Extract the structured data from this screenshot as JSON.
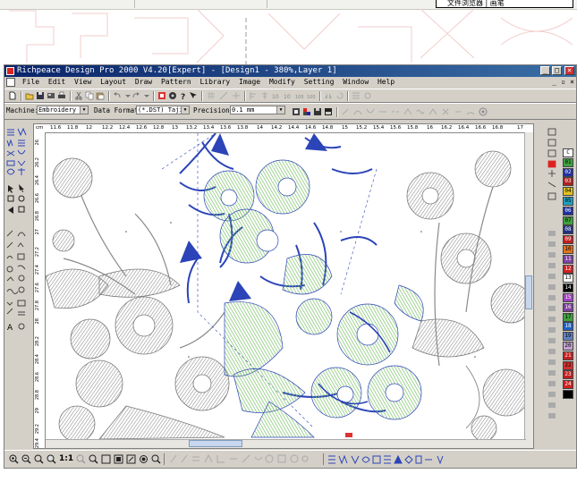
{
  "window": {
    "title": "Richpeace Design Pro 2000 V4.20[Expert] - [Design1 - 380%,Layer 1]",
    "controls": {
      "minimize": "_",
      "maximize": "□",
      "close": "×"
    },
    "doc_controls": {
      "minimize": "_",
      "restore": "▫",
      "close": "×"
    }
  },
  "menu": [
    "File",
    "Edit",
    "View",
    "Layout",
    "Draw",
    "Pattern",
    "Library",
    "Image",
    "Modify",
    "Setting",
    "Window",
    "Help"
  ],
  "property_bar": {
    "machine_label": "Machine:",
    "machine_value": "Embroidery Ma",
    "data_format_label": "Data Format:",
    "data_format_value": "(*.DST) Tajim",
    "precision_label": "Precision:",
    "precision_value": "0.1 mm"
  },
  "ruler": {
    "unit": "cm",
    "x_ticks": [
      "11.6",
      "11.8",
      "12",
      "12.2",
      "12.4",
      "12.6",
      "12.8",
      "13",
      "13.2",
      "13.4",
      "13.6",
      "13.8",
      "14",
      "14.2",
      "14.4",
      "14.6",
      "14.8",
      "15",
      "15.2",
      "15.4",
      "15.6",
      "15.8",
      "16",
      "16.2",
      "16.4",
      "16.6",
      "16.8",
      "17"
    ],
    "y_ticks": [
      "26",
      "26.2",
      "26.4",
      "26.6",
      "26.8",
      "27",
      "27.2",
      "27.4",
      "27.6",
      "27.8",
      "28",
      "28.2",
      "28.4",
      "28.6",
      "28.8",
      "29",
      "29.2",
      "29.4"
    ]
  },
  "color_palette": [
    {
      "num": "C",
      "color": "#ffffff"
    },
    {
      "num": "01",
      "color": "#40a040"
    },
    {
      "num": "02",
      "color": "#2030a0"
    },
    {
      "num": "03",
      "color": "#b02020"
    },
    {
      "num": "04",
      "color": "#e0c020"
    },
    {
      "num": "05",
      "color": "#20a0c0"
    },
    {
      "num": "06",
      "color": "#2030a0"
    },
    {
      "num": "07",
      "color": "#40a040"
    },
    {
      "num": "08",
      "color": "#203080"
    },
    {
      "num": "09",
      "color": "#c02020"
    },
    {
      "num": "10",
      "color": "#e07020"
    },
    {
      "num": "11",
      "color": "#8040a0"
    },
    {
      "num": "12",
      "color": "#d02020"
    },
    {
      "num": "13",
      "color": "#ffffff"
    },
    {
      "num": "14",
      "color": "#000000"
    },
    {
      "num": "15",
      "color": "#a040c0"
    },
    {
      "num": "16",
      "color": "#8040a0"
    },
    {
      "num": "17",
      "color": "#40a040"
    },
    {
      "num": "18",
      "color": "#2060c0"
    },
    {
      "num": "19",
      "color": "#6080c0"
    },
    {
      "num": "20",
      "color": "#c0a0d0"
    },
    {
      "num": "21",
      "color": "#c02020"
    },
    {
      "num": "22",
      "color": "#d03030"
    },
    {
      "num": "23",
      "color": "#c02020"
    },
    {
      "num": "24",
      "color": "#d02020"
    },
    {
      "num": "",
      "color": "#000000"
    }
  ],
  "zoom_tools": {
    "zoom_1to1": "1:1"
  },
  "top_strip": {
    "box_text": "文件浏览器 | 画笔"
  },
  "colors": {
    "title_start": "#0a246a",
    "title_end": "#3a6ea5",
    "chrome": "#d4d0c8",
    "stitch_gray": "#8a8a8a",
    "stitch_green": "#7cc56a",
    "stitch_blue": "#2b44b8",
    "bg_pattern": "#f2c8c8"
  }
}
